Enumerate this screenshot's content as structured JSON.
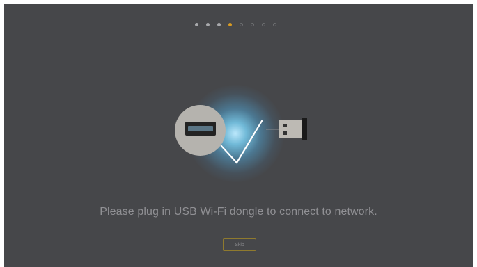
{
  "wizard": {
    "steps_total": 8,
    "current_step": 4
  },
  "illustration": {
    "left_icon": "usb-port-icon",
    "center_icon": "checkmark-icon",
    "right_icon": "usb-dongle-icon",
    "glow_color": "#9fe2ff"
  },
  "message": "Please plug in USB Wi-Fi dongle to connect to network.",
  "skip_label": "Skip",
  "colors": {
    "background": "#46474a",
    "accent": "#d89b22",
    "text": "#909094"
  }
}
